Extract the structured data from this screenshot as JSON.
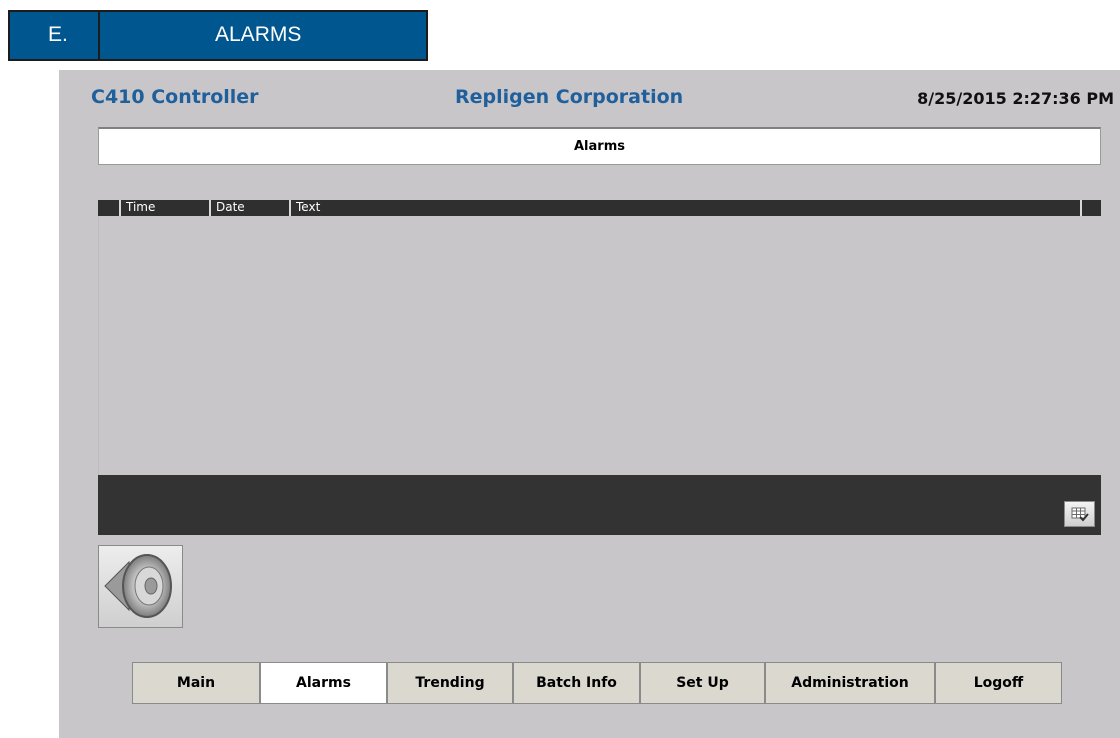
{
  "section": {
    "letter": "E.",
    "title": "ALARMS"
  },
  "header": {
    "app_title": "C410 Controller",
    "company": "Repligen Corporation",
    "datetime": "8/25/2015 2:27:36 PM"
  },
  "panel": {
    "title": "Alarms"
  },
  "alarm_table": {
    "columns": [
      "Time",
      "Date",
      "Text"
    ],
    "rows": []
  },
  "icons": {
    "acknowledge": "table-check-icon",
    "horn": "speaker-icon"
  },
  "nav": {
    "items": [
      "Main",
      "Alarms",
      "Trending",
      "Batch Info",
      "Set Up",
      "Administration",
      "Logoff"
    ],
    "active": "Alarms"
  },
  "colors": {
    "section_bar": "#00568f",
    "header_text": "#1f5f9b",
    "screen_bg": "#c8c6c9",
    "grid_dark": "#333333"
  }
}
